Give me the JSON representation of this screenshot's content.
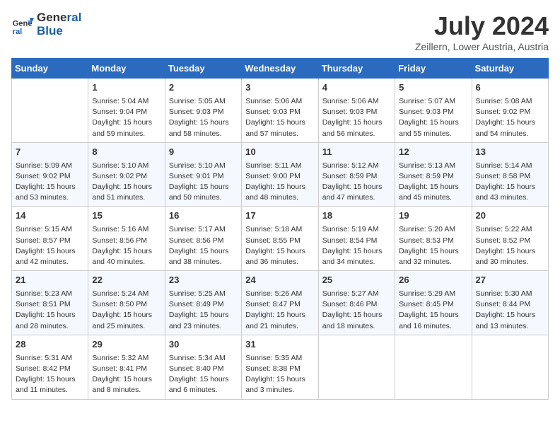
{
  "header": {
    "logo_line1": "General",
    "logo_line2": "Blue",
    "month_year": "July 2024",
    "location": "Zeillern, Lower Austria, Austria"
  },
  "days_of_week": [
    "Sunday",
    "Monday",
    "Tuesday",
    "Wednesday",
    "Thursday",
    "Friday",
    "Saturday"
  ],
  "weeks": [
    [
      {
        "day": "",
        "info": ""
      },
      {
        "day": "1",
        "info": "Sunrise: 5:04 AM\nSunset: 9:04 PM\nDaylight: 15 hours\nand 59 minutes."
      },
      {
        "day": "2",
        "info": "Sunrise: 5:05 AM\nSunset: 9:03 PM\nDaylight: 15 hours\nand 58 minutes."
      },
      {
        "day": "3",
        "info": "Sunrise: 5:06 AM\nSunset: 9:03 PM\nDaylight: 15 hours\nand 57 minutes."
      },
      {
        "day": "4",
        "info": "Sunrise: 5:06 AM\nSunset: 9:03 PM\nDaylight: 15 hours\nand 56 minutes."
      },
      {
        "day": "5",
        "info": "Sunrise: 5:07 AM\nSunset: 9:03 PM\nDaylight: 15 hours\nand 55 minutes."
      },
      {
        "day": "6",
        "info": "Sunrise: 5:08 AM\nSunset: 9:02 PM\nDaylight: 15 hours\nand 54 minutes."
      }
    ],
    [
      {
        "day": "7",
        "info": "Sunrise: 5:09 AM\nSunset: 9:02 PM\nDaylight: 15 hours\nand 53 minutes."
      },
      {
        "day": "8",
        "info": "Sunrise: 5:10 AM\nSunset: 9:02 PM\nDaylight: 15 hours\nand 51 minutes."
      },
      {
        "day": "9",
        "info": "Sunrise: 5:10 AM\nSunset: 9:01 PM\nDaylight: 15 hours\nand 50 minutes."
      },
      {
        "day": "10",
        "info": "Sunrise: 5:11 AM\nSunset: 9:00 PM\nDaylight: 15 hours\nand 48 minutes."
      },
      {
        "day": "11",
        "info": "Sunrise: 5:12 AM\nSunset: 8:59 PM\nDaylight: 15 hours\nand 47 minutes."
      },
      {
        "day": "12",
        "info": "Sunrise: 5:13 AM\nSunset: 8:59 PM\nDaylight: 15 hours\nand 45 minutes."
      },
      {
        "day": "13",
        "info": "Sunrise: 5:14 AM\nSunset: 8:58 PM\nDaylight: 15 hours\nand 43 minutes."
      }
    ],
    [
      {
        "day": "14",
        "info": "Sunrise: 5:15 AM\nSunset: 8:57 PM\nDaylight: 15 hours\nand 42 minutes."
      },
      {
        "day": "15",
        "info": "Sunrise: 5:16 AM\nSunset: 8:56 PM\nDaylight: 15 hours\nand 40 minutes."
      },
      {
        "day": "16",
        "info": "Sunrise: 5:17 AM\nSunset: 8:56 PM\nDaylight: 15 hours\nand 38 minutes."
      },
      {
        "day": "17",
        "info": "Sunrise: 5:18 AM\nSunset: 8:55 PM\nDaylight: 15 hours\nand 36 minutes."
      },
      {
        "day": "18",
        "info": "Sunrise: 5:19 AM\nSunset: 8:54 PM\nDaylight: 15 hours\nand 34 minutes."
      },
      {
        "day": "19",
        "info": "Sunrise: 5:20 AM\nSunset: 8:53 PM\nDaylight: 15 hours\nand 32 minutes."
      },
      {
        "day": "20",
        "info": "Sunrise: 5:22 AM\nSunset: 8:52 PM\nDaylight: 15 hours\nand 30 minutes."
      }
    ],
    [
      {
        "day": "21",
        "info": "Sunrise: 5:23 AM\nSunset: 8:51 PM\nDaylight: 15 hours\nand 28 minutes."
      },
      {
        "day": "22",
        "info": "Sunrise: 5:24 AM\nSunset: 8:50 PM\nDaylight: 15 hours\nand 25 minutes."
      },
      {
        "day": "23",
        "info": "Sunrise: 5:25 AM\nSunset: 8:49 PM\nDaylight: 15 hours\nand 23 minutes."
      },
      {
        "day": "24",
        "info": "Sunrise: 5:26 AM\nSunset: 8:47 PM\nDaylight: 15 hours\nand 21 minutes."
      },
      {
        "day": "25",
        "info": "Sunrise: 5:27 AM\nSunset: 8:46 PM\nDaylight: 15 hours\nand 18 minutes."
      },
      {
        "day": "26",
        "info": "Sunrise: 5:29 AM\nSunset: 8:45 PM\nDaylight: 15 hours\nand 16 minutes."
      },
      {
        "day": "27",
        "info": "Sunrise: 5:30 AM\nSunset: 8:44 PM\nDaylight: 15 hours\nand 13 minutes."
      }
    ],
    [
      {
        "day": "28",
        "info": "Sunrise: 5:31 AM\nSunset: 8:42 PM\nDaylight: 15 hours\nand 11 minutes."
      },
      {
        "day": "29",
        "info": "Sunrise: 5:32 AM\nSunset: 8:41 PM\nDaylight: 15 hours\nand 8 minutes."
      },
      {
        "day": "30",
        "info": "Sunrise: 5:34 AM\nSunset: 8:40 PM\nDaylight: 15 hours\nand 6 minutes."
      },
      {
        "day": "31",
        "info": "Sunrise: 5:35 AM\nSunset: 8:38 PM\nDaylight: 15 hours\nand 3 minutes."
      },
      {
        "day": "",
        "info": ""
      },
      {
        "day": "",
        "info": ""
      },
      {
        "day": "",
        "info": ""
      }
    ]
  ]
}
